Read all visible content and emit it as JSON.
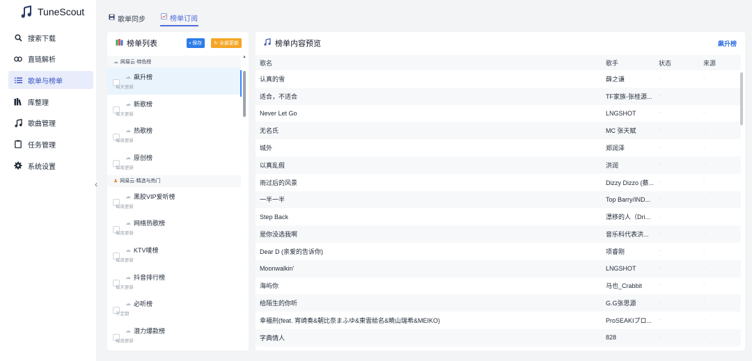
{
  "app": {
    "title": "TuneScout"
  },
  "sidebar": {
    "items": [
      {
        "label": "搜索下载",
        "icon": "search-icon"
      },
      {
        "label": "直链解析",
        "icon": "link-icon"
      },
      {
        "label": "歌单与榜单",
        "icon": "list-icon"
      },
      {
        "label": "库整理",
        "icon": "library-icon"
      },
      {
        "label": "歌曲管理",
        "icon": "music-note-icon"
      },
      {
        "label": "任务管理",
        "icon": "clipboard-icon"
      },
      {
        "label": "系统设置",
        "icon": "gear-icon"
      }
    ],
    "active_index": 2
  },
  "tabs": [
    {
      "label": "歌单同步",
      "icon": "save-icon"
    },
    {
      "label": "榜单订阅",
      "icon": "chart-icon"
    }
  ],
  "left_panel": {
    "title": "榜单列表",
    "save_label": "保存",
    "update_all_label": "全部更新",
    "groups": [
      {
        "label": "网易云·特色榜",
        "items": [
          {
            "name": "飙升榜",
            "freq": "每天更新"
          },
          {
            "name": "新歌榜",
            "freq": "每天更新"
          },
          {
            "name": "热歌榜",
            "freq": "每周更新"
          },
          {
            "name": "原创榜",
            "freq": "每周更新"
          }
        ]
      },
      {
        "label": "网易云·精选与热门",
        "items": [
          {
            "name": "黑胶VIP爱听榜",
            "freq": "每周更新"
          },
          {
            "name": "网络热歌榜",
            "freq": "每周更新"
          },
          {
            "name": "KTV唛榜",
            "freq": "每周更新"
          },
          {
            "name": "抖音排行榜",
            "freq": "每天更新"
          },
          {
            "name": "必听榜",
            "freq": "不定期"
          },
          {
            "name": "潜力爆款榜",
            "freq": "每周更新"
          }
        ]
      }
    ]
  },
  "right_panel": {
    "title": "榜单内容预览",
    "chart_name": "飙升榜",
    "columns": [
      "歌名",
      "歌手",
      "状态",
      "来源"
    ],
    "placeholder": "-",
    "rows": [
      {
        "song": "认真的雪",
        "artist": "薛之谦"
      },
      {
        "song": "适合，不适合",
        "artist": "TF家族-张桂源..."
      },
      {
        "song": "Never Let Go",
        "artist": "LNGSHOT"
      },
      {
        "song": "无名氏",
        "artist": "MC 张天赋"
      },
      {
        "song": "城外",
        "artist": "郑润泽"
      },
      {
        "song": "以真乱假",
        "artist": "洪润"
      },
      {
        "song": "雨过后的风景",
        "artist": "Dizzy Dizzo (蔡..."
      },
      {
        "song": "一半一半",
        "artist": "Top Barry/IND..."
      },
      {
        "song": "Step Back",
        "artist": "漂移的人（Dri..."
      },
      {
        "song": "是你没选我啊",
        "artist": "音乐科代表洪..."
      },
      {
        "song": "Dear D (亲爱的告诉你)",
        "artist": "项睿刚"
      },
      {
        "song": "Moonwalkin'",
        "artist": "LNGSHOT"
      },
      {
        "song": "海屿你",
        "artist": "马也_Crabbit"
      },
      {
        "song": "给陌生的你听",
        "artist": "G.G张思源"
      },
      {
        "song": "幸福刑(feat. 宵崎奏&朝比奈まふゆ&東雲絵名&暁山瑞希&MEIKO)",
        "artist": "ProSEAKIプロ..."
      },
      {
        "song": "字典情人",
        "artist": "828"
      }
    ]
  }
}
